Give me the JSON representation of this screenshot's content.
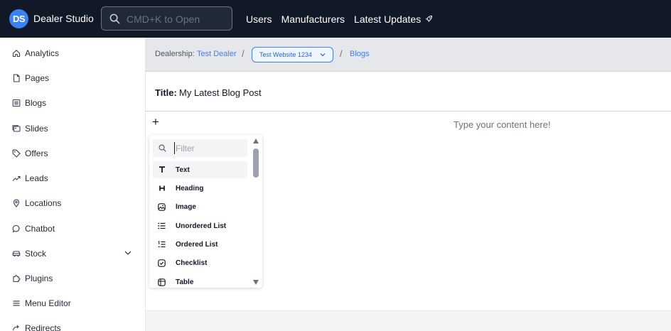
{
  "app": {
    "logo_text": "DS",
    "name": "Dealer Studio",
    "accent": "#3b82f6",
    "topbar_bg": "#111827"
  },
  "search": {
    "placeholder": "CMD+K to Open",
    "icon": "search-icon"
  },
  "topnav": {
    "users": "Users",
    "manufacturers": "Manufacturers",
    "latest_updates": "Latest Updates",
    "latest_updates_icon": "rocket-icon"
  },
  "sidebar": {
    "items": [
      {
        "label": "Analytics",
        "icon": "home-icon"
      },
      {
        "label": "Pages",
        "icon": "page-icon"
      },
      {
        "label": "Blogs",
        "icon": "blog-icon"
      },
      {
        "label": "Slides",
        "icon": "slides-icon"
      },
      {
        "label": "Offers",
        "icon": "tag-icon"
      },
      {
        "label": "Leads",
        "icon": "trending-icon"
      },
      {
        "label": "Locations",
        "icon": "location-pin-icon"
      },
      {
        "label": "Chatbot",
        "icon": "chat-icon"
      },
      {
        "label": "Stock",
        "icon": "car-icon",
        "expandable": true
      },
      {
        "label": "Plugins",
        "icon": "puzzle-icon"
      },
      {
        "label": "Menu Editor",
        "icon": "menu-icon"
      },
      {
        "label": "Redirects",
        "icon": "redirect-icon"
      }
    ]
  },
  "breadcrumb": {
    "dealership_label": "Dealership:",
    "dealership_value": "Test Dealer",
    "separator": "/",
    "website_select": "Test Website 1234",
    "section": "Blogs"
  },
  "post": {
    "title_label": "Title:",
    "title_value": "My Latest Blog Post"
  },
  "editor": {
    "add_symbol": "+",
    "placeholder": "Type your content here!"
  },
  "block_menu": {
    "filter_placeholder": "Filter",
    "options": [
      {
        "label": "Text",
        "icon": "text-icon",
        "active": true
      },
      {
        "label": "Heading",
        "icon": "heading-icon"
      },
      {
        "label": "Image",
        "icon": "image-icon"
      },
      {
        "label": "Unordered List",
        "icon": "unordered-list-icon"
      },
      {
        "label": "Ordered List",
        "icon": "ordered-list-icon"
      },
      {
        "label": "Checklist",
        "icon": "checklist-icon"
      },
      {
        "label": "Table",
        "icon": "table-icon"
      }
    ]
  }
}
